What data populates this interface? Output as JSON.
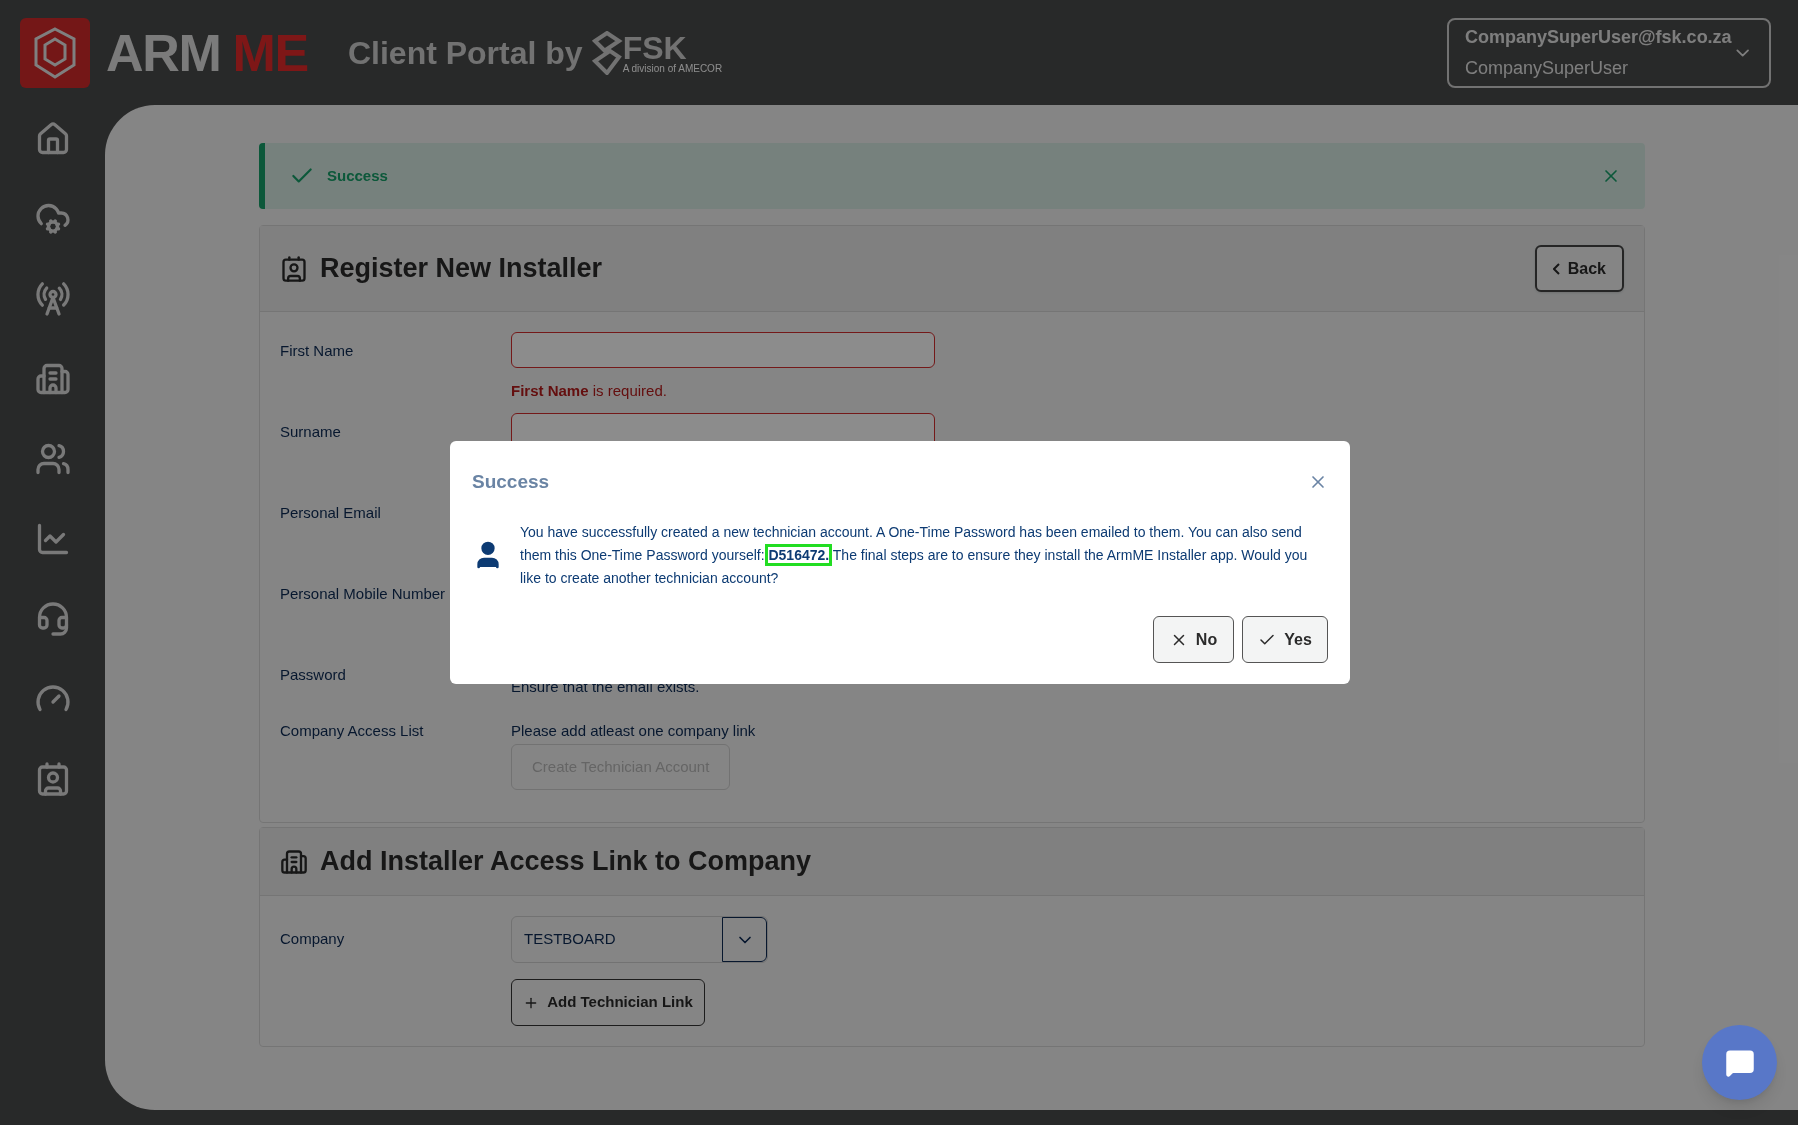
{
  "header": {
    "logo_left": "ARM",
    "logo_right": "ME",
    "portal": "Client Portal by",
    "brand": "FSK",
    "brand_sub": "A division of AMECOR",
    "user_email": "CompanySuperUser@fsk.co.za",
    "user_name": "CompanySuperUser"
  },
  "alert": {
    "text": "Success"
  },
  "register": {
    "title": "Register New Installer",
    "back": "Back",
    "fields": [
      {
        "label": "First Name",
        "kind": "input",
        "invalid": true,
        "error": "**First Name** is required."
      },
      {
        "label": "Surname",
        "kind": "input",
        "invalid": true
      },
      {
        "label": "Personal Email",
        "kind": "hidden"
      },
      {
        "label": "Personal Mobile Number",
        "kind": "hidden"
      },
      {
        "label": "Password",
        "kind": "note_below",
        "note": "Ensure that the email exists."
      },
      {
        "label": "Company Access List",
        "kind": "note",
        "note": "Please add atleast one company link"
      }
    ],
    "submit": {
      "label": "Create Technician Account",
      "disabled": true
    }
  },
  "company": {
    "title": "Add Installer Access Link to Company",
    "label": "Company",
    "value": "TESTBOARD",
    "button": "Add Technician Link"
  },
  "modal": {
    "title": "Success",
    "message": "You have successfully created a new technician account. A One-Time Password has been emailed to them. You can also send them this One-Time Password yourself: **D516472.** The final steps are to ensure they install the ArmME Installer app. Would you like to create another technician account?",
    "buttons": [
      {
        "kind": "no",
        "label": "No"
      },
      {
        "kind": "yes",
        "label": "Yes"
      }
    ]
  }
}
